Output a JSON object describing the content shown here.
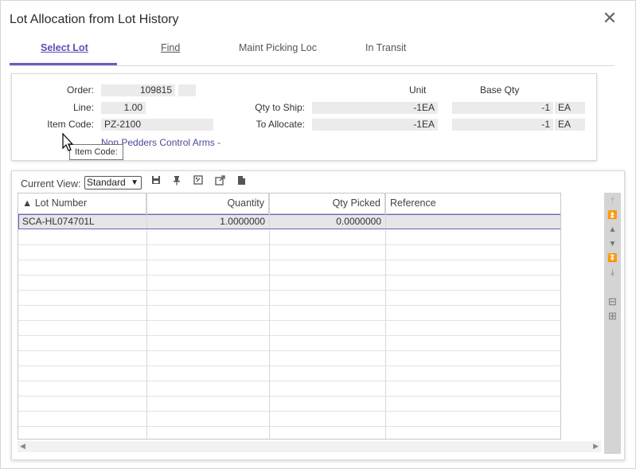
{
  "dialog": {
    "title": "Lot Allocation from Lot History",
    "close_glyph": "✕"
  },
  "tabs": [
    {
      "label": "Select Lot",
      "active": true
    },
    {
      "label": "Find",
      "active": false
    },
    {
      "label": "Maint Picking Loc",
      "active": false
    },
    {
      "label": "In Transit",
      "active": false
    }
  ],
  "header": {
    "order_label": "Order:",
    "order_value": "109815",
    "order_suffix": "",
    "line_label": "Line:",
    "line_value": "1.00",
    "item_code_label": "Item Code:",
    "item_code_value": "PZ-2100",
    "item_description": "Non Pedders Control Arms -",
    "unit_header": "Unit",
    "base_qty_header": "Base Qty",
    "qty_to_ship_label": "Qty to Ship:",
    "qty_to_ship_unit": "-1EA",
    "qty_to_ship_base": "-1",
    "qty_to_ship_uom": "EA",
    "to_allocate_label": "To Allocate:",
    "to_allocate_unit": "-1EA",
    "to_allocate_base": "-1",
    "to_allocate_uom": "EA",
    "tooltip_text": "Item Code:"
  },
  "grid": {
    "current_view_label": "Current View:",
    "current_view_value": "Standard",
    "toolbar_icons": [
      "save-icon",
      "pin-icon",
      "edit-view-icon",
      "export-icon",
      "document-icon"
    ],
    "columns": [
      "▲ Lot Number",
      "Quantity",
      "Qty Picked",
      "Reference"
    ],
    "rows": [
      {
        "lot_number": "SCA-HL074701L",
        "quantity": "1.0000000",
        "qty_picked": "0.0000000",
        "reference": ""
      }
    ],
    "empty_row_count": 14,
    "nav_icons": [
      "first-icon",
      "page-up-icon",
      "up-icon",
      "down-icon",
      "page-down-icon",
      "last-icon",
      "collapse-icon",
      "expand-icon"
    ]
  },
  "colors": {
    "accent": "#6a5cc7",
    "field_bg": "#ebebeb",
    "nav_bar": "#d4d4d4"
  }
}
